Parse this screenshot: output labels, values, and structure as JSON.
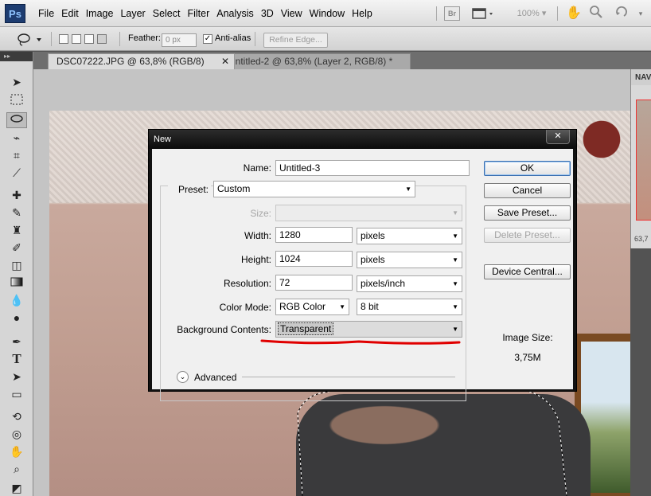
{
  "menubar": {
    "logo": "Ps",
    "items": [
      "File",
      "Edit",
      "Image",
      "Layer",
      "Select",
      "Filter",
      "Analysis",
      "3D",
      "View",
      "Window",
      "Help"
    ],
    "bridge_label": "Br",
    "zoom": "100%"
  },
  "options": {
    "feather_label": "Feather:",
    "feather_value": "0 px",
    "antialias_label": "Anti-alias",
    "antialias_checked": true,
    "refine_edge": "Refine Edge..."
  },
  "tabs": [
    {
      "label": "DSC07222.JPG @ 63,8% (RGB/8)",
      "active": true
    },
    {
      "label": "Untitled-2 @ 63,8% (Layer 2, RGB/8) *",
      "active": false
    }
  ],
  "navigator": {
    "title": "NAV",
    "zoom": "63,7"
  },
  "dialog": {
    "title": "New",
    "close": "✕",
    "name_label": "Name:",
    "name_value": "Untitled-3",
    "preset_label": "Preset:",
    "preset_value": "Custom",
    "size_label": "Size:",
    "size_value": "",
    "width_label": "Width:",
    "width_value": "1280",
    "width_unit": "pixels",
    "height_label": "Height:",
    "height_value": "1024",
    "height_unit": "pixels",
    "resolution_label": "Resolution:",
    "resolution_value": "72",
    "resolution_unit": "pixels/inch",
    "color_mode_label": "Color Mode:",
    "color_mode_value": "RGB Color",
    "bit_depth": "8 bit",
    "bg_label": "Background Contents:",
    "bg_value": "Transparent",
    "advanced_label": "Advanced",
    "buttons": {
      "ok": "OK",
      "cancel": "Cancel",
      "save_preset": "Save Preset...",
      "delete_preset": "Delete Preset...",
      "device_central": "Device Central..."
    },
    "image_size_label": "Image Size:",
    "image_size_value": "3,75M"
  },
  "colors": {
    "annotation_red": "#e00000",
    "dialog_frame": "#111111",
    "default_button_border": "#3a6fb0"
  }
}
